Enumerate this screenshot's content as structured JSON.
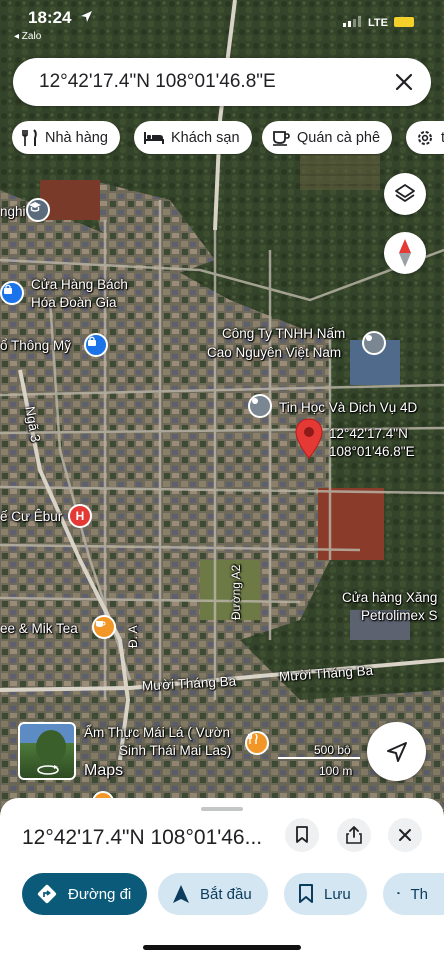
{
  "status": {
    "time": "18:24",
    "back_app": "◂ Zalo",
    "network": "LTE"
  },
  "search": {
    "query": "12°42'17.4\"N 108°01'46.8\"E"
  },
  "chips": [
    {
      "label": "Nhà hàng",
      "icon": "fork-knife-icon"
    },
    {
      "label": "Khách sạn",
      "icon": "bed-icon"
    },
    {
      "label": "Quán cà phê",
      "icon": "coffee-icon"
    },
    {
      "label": "tì",
      "icon": "gear-icon"
    }
  ],
  "map": {
    "labels": {
      "nghi": "nghi",
      "store1": "Cửa Hàng Bách",
      "store2": "Hóa Đoàn Gia",
      "school": "ổ Thông Mỹ",
      "company1": "Công Ty TNHH Nấm",
      "company2": "Cao Nguyên Việt Nam",
      "tinhoc": "Tin Học Và Dịch Vụ 4D",
      "coord1": "12°42'17.4\"N",
      "coord2": "108°01'46.8\"E",
      "nga3": "Ngã 3",
      "ebur": "ế Cư Êbur",
      "gas1": "Cửa hàng Xăng",
      "gas2": "Petrolimex S",
      "duonga2": "Đường A2",
      "tea": "ee & Mik Tea",
      "da": "Đ. A",
      "mtb1": "Mười Tháng Ba",
      "mtb2": "Mười Tháng Ba",
      "food1": "Ẩm Thực Mái Lá ( Vườn",
      "food2": "Sinh Thái Mai Las)",
      "maps": "Maps",
      "scale_ft": "500 bộ",
      "scale_m": "100 m"
    }
  },
  "sheet": {
    "title": "12°42'17.4\"N 108°01'46...",
    "actions": [
      {
        "label": "Đường đi",
        "icon": "directions-icon"
      },
      {
        "label": "Bắt đầu",
        "icon": "navigation-arrow-icon"
      },
      {
        "label": "Lưu",
        "icon": "bookmark-icon"
      },
      {
        "label": "Th",
        "icon": "flag-icon"
      }
    ]
  },
  "colors": {
    "accent": "#0b5a7a",
    "pin_red": "#e53935",
    "chip_bg": "#ffffff",
    "action_bg": "#d3e6f2"
  }
}
